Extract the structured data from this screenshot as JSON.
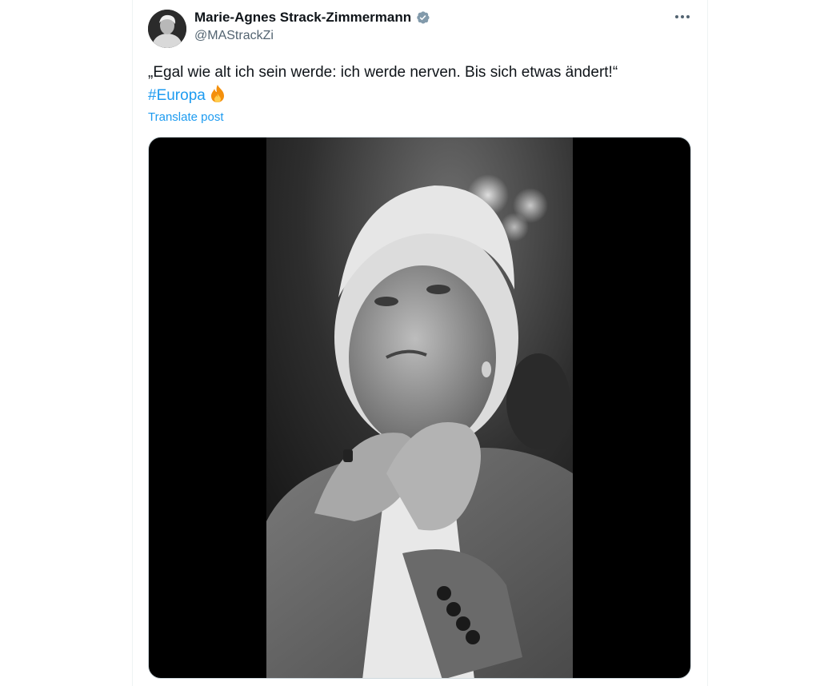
{
  "post": {
    "author": {
      "display_name": "Marie-Agnes Strack-Zimmermann",
      "handle": "@MAStrackZi",
      "verified_icon": "verified-badge-icon"
    },
    "text": "„Egal wie alt ich sein werde: ich werde nerven. Bis sich etwas ändert!“",
    "hashtag": "#Europa",
    "emoji": "fire-emoji",
    "translate_label": "Translate post",
    "more_icon": "more-options-icon"
  },
  "colors": {
    "link": "#1d9bf0",
    "text": "#0f1419",
    "secondary": "#536471",
    "verified": "#829aab"
  }
}
